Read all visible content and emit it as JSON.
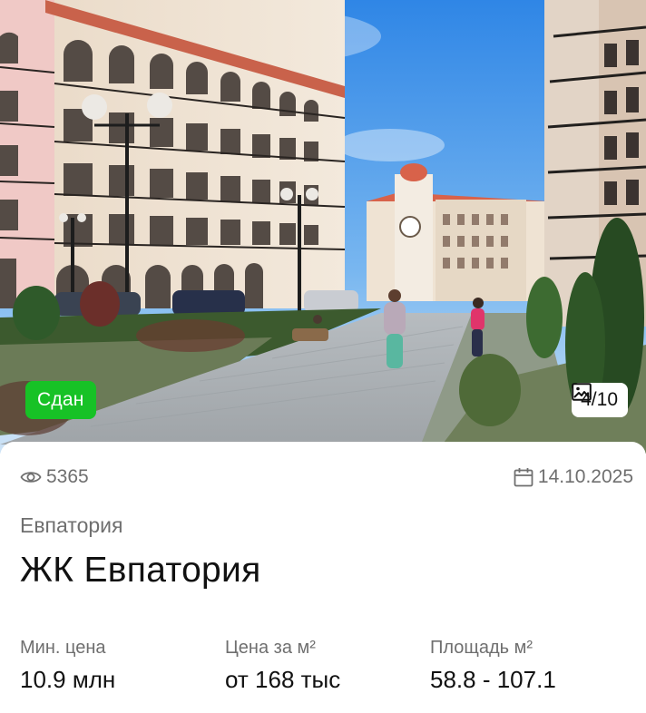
{
  "listing": {
    "status": "Сдан",
    "photo_counter": "4/10",
    "views": "5365",
    "date": "14.10.2025",
    "city": "Евпатория",
    "title": "ЖК Евпатория",
    "stats": [
      {
        "label": "Мин. цена",
        "value": "10.9 млн"
      },
      {
        "label": "Цена за м²",
        "value": "от 168 тыс"
      },
      {
        "label": "Площадь м²",
        "value": "58.8 - 107.1"
      }
    ]
  },
  "icons": {
    "views": "eye-icon",
    "date": "calendar-icon",
    "photos": "image-gallery-icon"
  },
  "colors": {
    "status_badge": "#17c226",
    "muted_text": "#6f6f6f",
    "primary_text": "#111111"
  }
}
